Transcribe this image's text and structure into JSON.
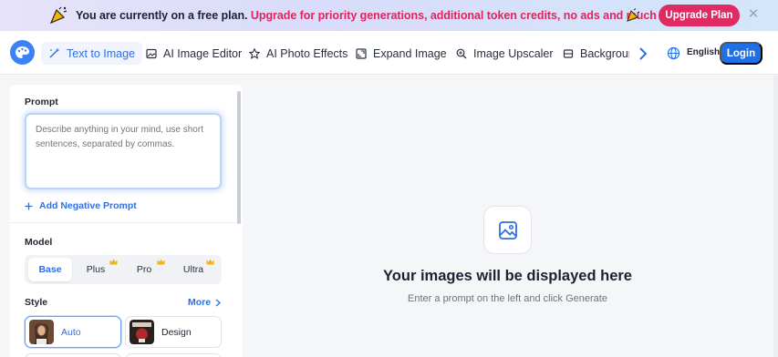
{
  "banner": {
    "text_plain": "You are currently on a free plan. ",
    "text_highlight": "Upgrade for priority generations, additional token credits, no ads and much more!",
    "upgrade_label": "Upgrade Plan",
    "close_glyph": "✕",
    "icon": "party-popper-icon"
  },
  "nav": {
    "tabs": [
      {
        "label": "Text to Image",
        "icon": "sparkle-wand-icon",
        "active": true
      },
      {
        "label": "AI Image Editor",
        "icon": "image-edit-icon"
      },
      {
        "label": "AI Photo Effects",
        "icon": "star-icon"
      },
      {
        "label": "Expand Image",
        "icon": "expand-icon"
      },
      {
        "label": "Image Upscaler",
        "icon": "zoom-in-icon"
      },
      {
        "label": "Background",
        "icon": "layers-icon"
      }
    ],
    "language": "English",
    "login_label": "Login"
  },
  "panel": {
    "prompt_label": "Prompt",
    "prompt_placeholder": "Describe anything in your mind, use short sentences, separated by commas.",
    "prompt_value": "",
    "negative_prompt_label": "Add Negative Prompt",
    "model_label": "Model",
    "models": [
      {
        "label": "Base",
        "active": true,
        "premium": false
      },
      {
        "label": "Plus",
        "premium": true
      },
      {
        "label": "Pro",
        "premium": true
      },
      {
        "label": "Ultra",
        "premium": true
      }
    ],
    "style_label": "Style",
    "more_label": "More",
    "styles": [
      {
        "label": "Auto",
        "active": true
      },
      {
        "label": "Design",
        "active": false
      }
    ]
  },
  "main": {
    "empty_title": "Your images will be displayed here",
    "empty_subtitle": "Enter a prompt on the left and click Generate"
  },
  "colors": {
    "accent": "#1f6fe5",
    "highlight": "#e0245e",
    "upgrade_button": "#e02a63"
  }
}
